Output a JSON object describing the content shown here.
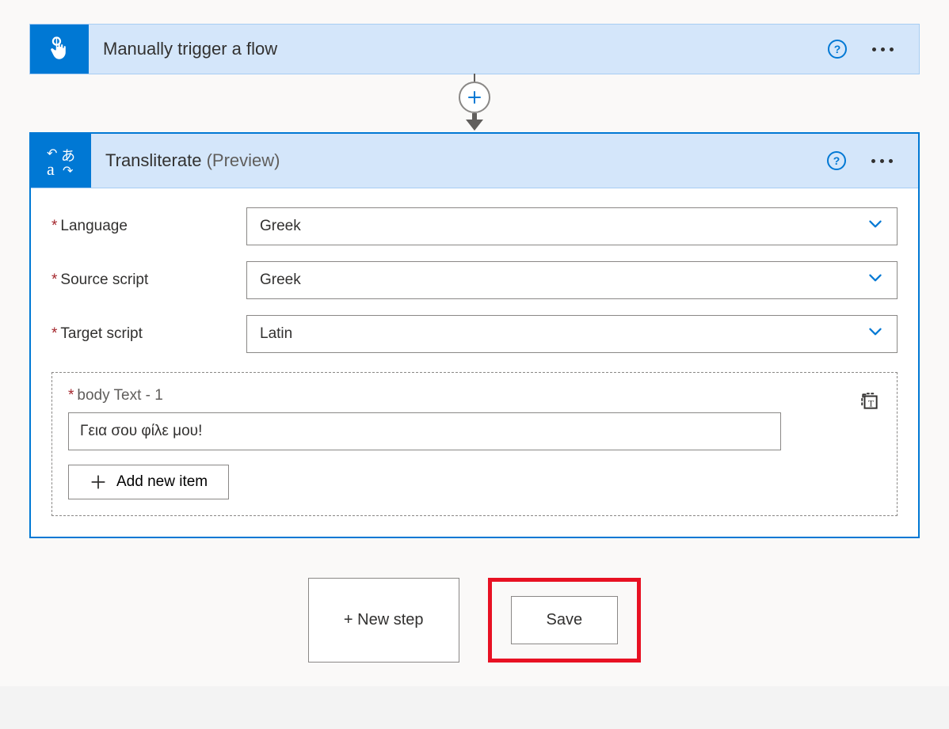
{
  "trigger": {
    "title": "Manually trigger a flow"
  },
  "action": {
    "title": "Transliterate",
    "suffix": "(Preview)",
    "fields": {
      "language": {
        "label": "Language",
        "value": "Greek"
      },
      "source_script": {
        "label": "Source script",
        "value": "Greek"
      },
      "target_script": {
        "label": "Target script",
        "value": "Latin"
      }
    },
    "body": {
      "label": "body Text - 1",
      "value": "Γεια σου φίλε μου!"
    },
    "add_item_label": "Add new item"
  },
  "footer": {
    "new_step": "+ New step",
    "save": "Save"
  }
}
